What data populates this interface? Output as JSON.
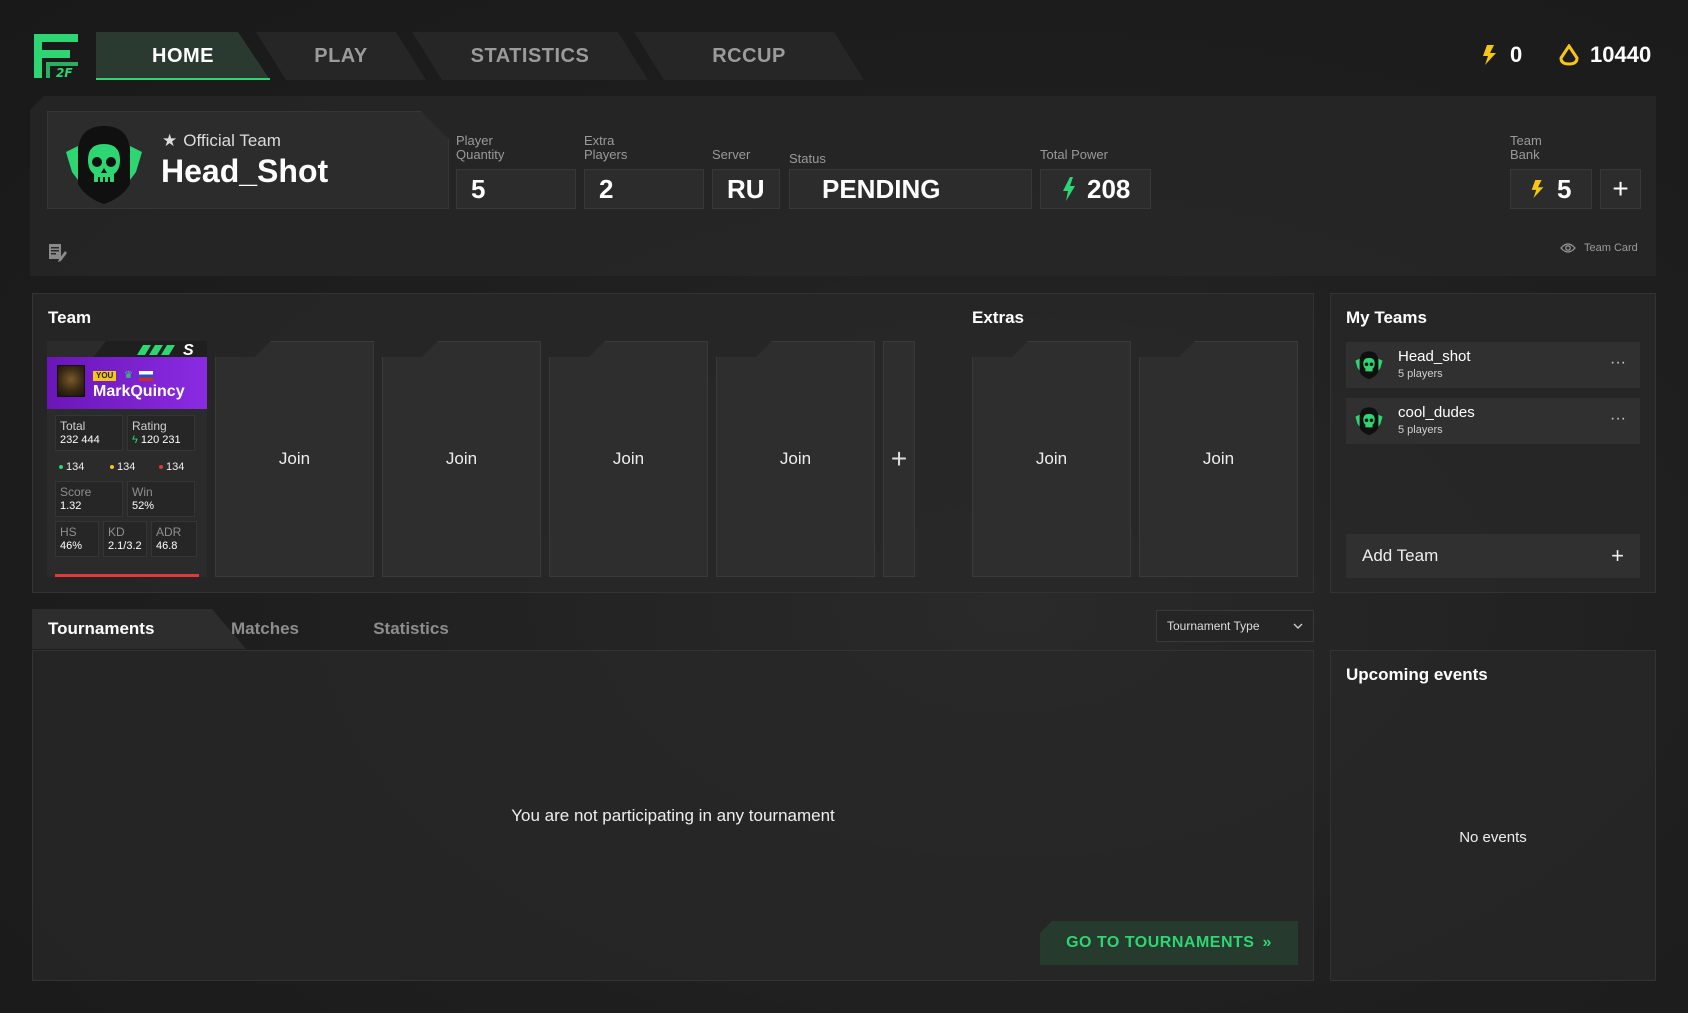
{
  "nav": {
    "tabs": [
      {
        "label": "HOME"
      },
      {
        "label": "PLAY"
      },
      {
        "label": "STATISTICS"
      },
      {
        "label": "RCCUP"
      }
    ],
    "coins": "0",
    "points": "10440",
    "logo_text": "2F"
  },
  "team": {
    "official_label": "Official Team",
    "name": "Head_Shot",
    "stats": {
      "player_quantity_label": "Player Quantity",
      "player_quantity": "5",
      "extra_players_label": "Extra Players",
      "extra_players": "2",
      "server_label": "Server",
      "server": "RU",
      "status_label": "Status",
      "status": "PENDING",
      "total_power_label": "Total Power",
      "total_power": "208",
      "bank_label": "Team Bank",
      "bank": "5"
    },
    "team_card_label": "Team Card"
  },
  "roster": {
    "title": "Team",
    "extras_title": "Extras",
    "join_label": "Join",
    "player": {
      "rank": "S",
      "you_badge": "YOU",
      "name": "MarkQuincy",
      "total_label": "Total",
      "total": "232 444",
      "rating_label": "Rating",
      "rating": "120 231",
      "kda": [
        "134",
        "134",
        "134"
      ],
      "score_label": "Score",
      "score": "1.32",
      "win_label": "Win",
      "win": "52%",
      "hs_label": "HS",
      "hs": "46%",
      "kd_label": "KD",
      "kd": "2.1/3.2",
      "adr_label": "ADR",
      "adr": "46.8"
    }
  },
  "my_teams": {
    "title": "My Teams",
    "items": [
      {
        "name": "Head_shot",
        "count": "5 players"
      },
      {
        "name": "cool_dudes",
        "count": "5 players"
      }
    ],
    "add_label": "Add Team"
  },
  "tabs": {
    "items": [
      {
        "label": "Tournaments"
      },
      {
        "label": "Matches"
      },
      {
        "label": "Statistics"
      }
    ],
    "filter_label": "Tournament Type"
  },
  "tournaments": {
    "empty_message": "You are not participating in any tournament",
    "go_label": "GO TO TOURNAMENTS"
  },
  "events": {
    "title": "Upcoming events",
    "empty": "No events"
  },
  "colors": {
    "accent": "#2ed573",
    "gold": "#f5c518",
    "purple": "#8a2be2"
  }
}
